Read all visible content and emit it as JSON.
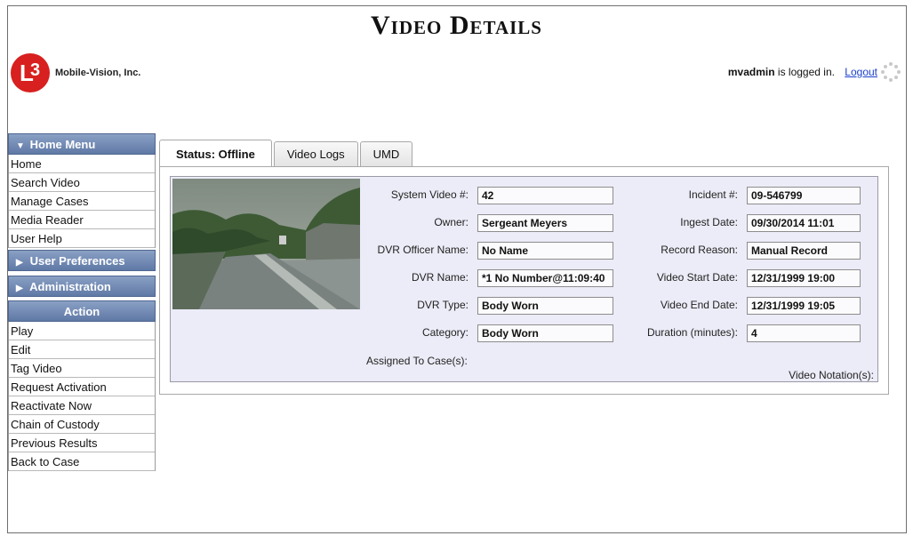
{
  "page": {
    "title": "Video Details"
  },
  "brand": {
    "logo_glyph": "L",
    "logo_digit": "3",
    "name": "Mobile-Vision, Inc.",
    "color": "#d7201f"
  },
  "session": {
    "username": "mvadmin",
    "status_text": "is logged in.",
    "logout_label": "Logout"
  },
  "sidebar": {
    "home_menu": {
      "label": "Home Menu",
      "icon": "triangle-down-icon",
      "items": [
        "Home",
        "Search Video",
        "Manage Cases",
        "Media Reader",
        "User Help"
      ]
    },
    "user_preferences": {
      "label": "User Preferences",
      "icon": "triangle-right-icon"
    },
    "administration": {
      "label": "Administration",
      "icon": "triangle-right-icon"
    },
    "action": {
      "label": "Action",
      "items": [
        "Play",
        "Edit",
        "Tag Video",
        "Request Activation",
        "Reactivate Now",
        "Chain of Custody",
        "Previous Results",
        "Back to Case"
      ]
    }
  },
  "tabs": [
    {
      "label": "Status: Offline",
      "active": true
    },
    {
      "label": "Video Logs",
      "active": false
    },
    {
      "label": "UMD",
      "active": false
    }
  ],
  "details": {
    "left": [
      {
        "label": "System Video #:",
        "value": "42"
      },
      {
        "label": "Owner:",
        "value": "Sergeant Meyers"
      },
      {
        "label": "DVR Officer Name:",
        "value": "No Name"
      },
      {
        "label": "DVR Name:",
        "value": "*1 No Number@11:09:40"
      },
      {
        "label": "DVR Type:",
        "value": "Body Worn"
      },
      {
        "label": "Category:",
        "value": "Body Worn"
      }
    ],
    "right": [
      {
        "label": "Incident #:",
        "value": "09-546799"
      },
      {
        "label": "Ingest Date:",
        "value": "09/30/2014 11:01"
      },
      {
        "label": "Record Reason:",
        "value": "Manual Record"
      },
      {
        "label": "Video Start Date:",
        "value": "12/31/1999 19:00"
      },
      {
        "label": "Video End Date:",
        "value": "12/31/1999 19:05"
      },
      {
        "label": "Duration (minutes):",
        "value": "4"
      }
    ],
    "assigned_label": "Assigned To Case(s):",
    "notation_label": "Video Notation(s):"
  },
  "colors": {
    "menu_header": "#6b84ae",
    "panel_bg": "#ececf8",
    "link": "#1a3fcc"
  }
}
